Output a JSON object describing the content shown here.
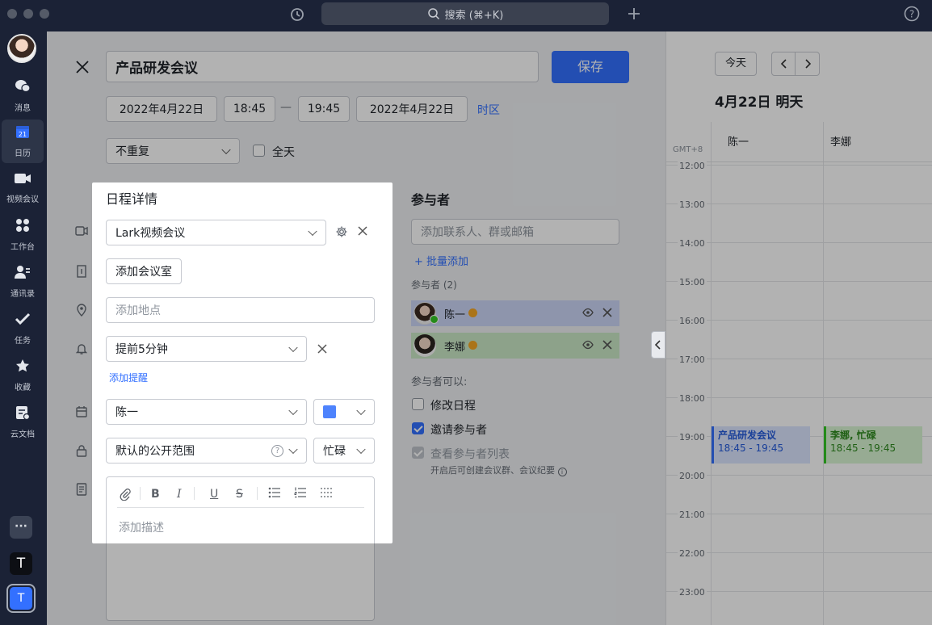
{
  "titlebar": {
    "search_placeholder": "搜索 (⌘+K)"
  },
  "nav": {
    "items": [
      {
        "label": "消息"
      },
      {
        "label": "日历",
        "badge": "21"
      },
      {
        "label": "视频会议"
      },
      {
        "label": "工作台"
      },
      {
        "label": "通讯录"
      },
      {
        "label": "任务"
      },
      {
        "label": "收藏"
      },
      {
        "label": "云文档"
      }
    ],
    "more_label": "···",
    "workspace_letters": [
      "T",
      "T"
    ]
  },
  "editor": {
    "title_value": "产品研发会议",
    "save_label": "保存",
    "start_date": "2022年4月22日",
    "start_time": "18:45",
    "dash": "—",
    "end_time": "19:45",
    "end_date": "2022年4月22日",
    "timezone_link": "时区",
    "repeat_value": "不重复",
    "allday_label": "全天"
  },
  "details": {
    "heading": "日程详情",
    "video_value": "Lark视频会议",
    "add_room_label": "添加会议室",
    "location_placeholder": "添加地点",
    "reminder_value": "提前5分钟",
    "add_reminder_link": "添加提醒",
    "calendar_owner": "陈一",
    "calendar_color": "#4e83fd",
    "visibility_value": "默认的公开范围",
    "busy_value": "忙碌",
    "desc_placeholder": "添加描述"
  },
  "attendees": {
    "heading": "参与者",
    "add_placeholder": "添加联系人、群或邮箱",
    "bulk_add_link": "批量添加",
    "count_label": "参与者 (2)",
    "list": [
      {
        "name": "陈一",
        "bg": "#ccd6f6"
      },
      {
        "name": "李娜",
        "bg": "#cbe9c6"
      }
    ],
    "can_label": "参与者可以:",
    "perms": [
      {
        "label": "修改日程",
        "state": "off"
      },
      {
        "label": "邀请参与者",
        "state": "on"
      },
      {
        "label": "查看参与者列表",
        "state": "disabled"
      }
    ],
    "perm_note": "开启后可创建会议群、会议纪要"
  },
  "calendar": {
    "today_label": "今天",
    "date_heading": "4月22日 明天",
    "tz_label": "GMT+8",
    "columns": [
      "陈一",
      "李娜"
    ],
    "hours": [
      "12:00",
      "13:00",
      "14:00",
      "15:00",
      "16:00",
      "17:00",
      "18:00",
      "19:00",
      "20:00",
      "21:00",
      "22:00",
      "23:00"
    ],
    "events": [
      {
        "title": "产品研发会议",
        "time": "18:45 - 19:45",
        "color": "#3370ff",
        "bg": "#dbe5ff",
        "text": "#245bdb"
      },
      {
        "title": "李娜, 忙碌",
        "time": "18:45 - 19:45",
        "color": "#34c724",
        "bg": "#d8f5d3",
        "text": "#2e8a1f"
      }
    ]
  }
}
